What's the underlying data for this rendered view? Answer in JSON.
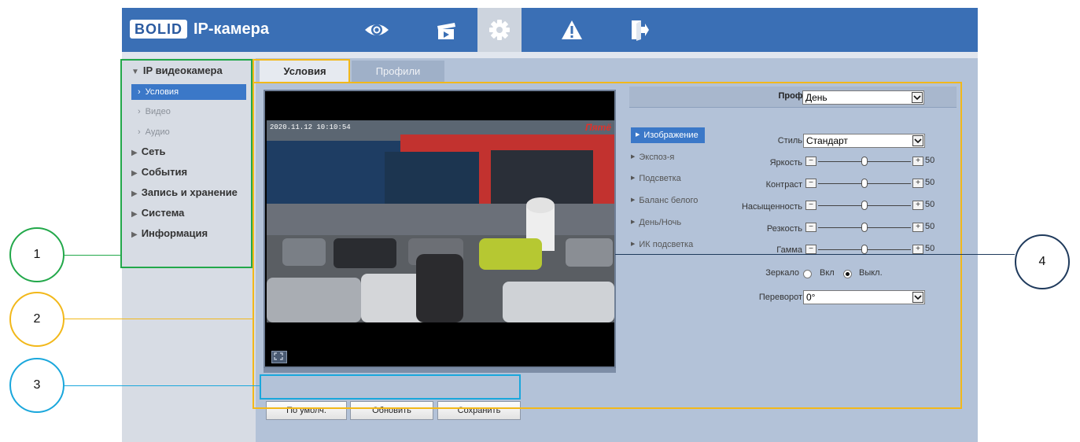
{
  "header": {
    "brand": "BOLID",
    "title": "IP-камера",
    "nav": [
      {
        "icon": "eye-icon"
      },
      {
        "icon": "clapperboard-icon"
      },
      {
        "icon": "gear-icon",
        "active": true
      },
      {
        "icon": "warning-icon"
      },
      {
        "icon": "logout-icon"
      }
    ],
    "color": "#3a6fb5"
  },
  "sidebar": {
    "groups": [
      {
        "label": "IP видеокамера",
        "expanded": true
      },
      {
        "label": "Сеть"
      },
      {
        "label": "События"
      },
      {
        "label": "Запись и хранение"
      },
      {
        "label": "Система"
      },
      {
        "label": "Информация"
      }
    ],
    "items": [
      {
        "label": "Условия",
        "active": true
      },
      {
        "label": "Видео"
      },
      {
        "label": "Аудио"
      }
    ]
  },
  "tabs": [
    {
      "label": "Условия",
      "active": true
    },
    {
      "label": "Профили"
    }
  ],
  "video": {
    "timestamp": "2020.11.12 10:10:54",
    "overlay_brand": "Пятё"
  },
  "buttons": {
    "default_label": "По умолч.",
    "refresh_label": "Обновить",
    "save_label": "Сохранить"
  },
  "settings": {
    "profile_label": "Профиль",
    "profile_value": "День",
    "menu": [
      {
        "label": "Изображение",
        "active": true
      },
      {
        "label": "Экспоз-я"
      },
      {
        "label": "Подсветка"
      },
      {
        "label": "Баланс белого"
      },
      {
        "label": "День/Ночь"
      },
      {
        "label": "ИК подсветка"
      }
    ],
    "style_label": "Стиль",
    "style_value": "Стандарт",
    "sliders": [
      {
        "label": "Яркость",
        "value": 50
      },
      {
        "label": "Контраст",
        "value": 50
      },
      {
        "label": "Насыщенность",
        "value": 50
      },
      {
        "label": "Резкость",
        "value": 50
      },
      {
        "label": "Гамма",
        "value": 50
      }
    ],
    "mirror_label": "Зеркало",
    "mirror_on": "Вкл",
    "mirror_off": "Выкл.",
    "mirror_value": "off",
    "flip_label": "Переворот",
    "flip_value": "0°"
  },
  "annotations": {
    "callouts": [
      {
        "label": "1",
        "color": "#22a84a"
      },
      {
        "label": "2",
        "color": "#f2b81a"
      },
      {
        "label": "3",
        "color": "#1aa7dc"
      },
      {
        "label": "4",
        "color": "#1f3a5c"
      }
    ]
  }
}
